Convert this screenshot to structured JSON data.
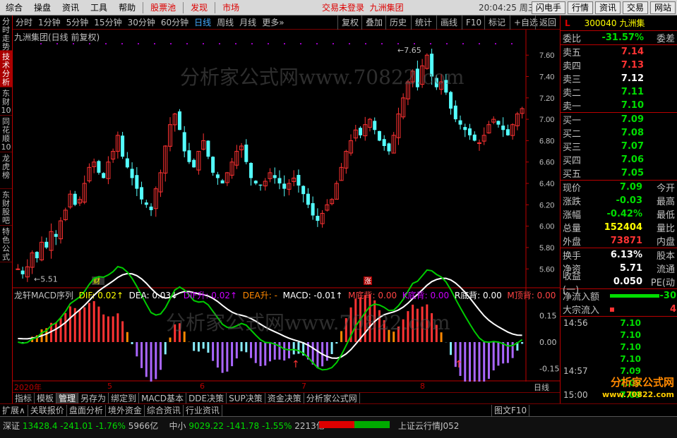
{
  "menu": {
    "items": [
      "综合",
      "操盘",
      "资讯",
      "工具",
      "帮助",
      "股票池",
      "发现",
      "市场"
    ],
    "status": "交易未登录",
    "stock_name": "九洲集团",
    "clock": "20:04:25 周三",
    "right_buttons": [
      "闪电手",
      "行情",
      "资讯",
      "交易",
      "网站"
    ]
  },
  "left_nav": [
    "分时走势",
    "技术分析",
    "东财10",
    "同花顺10",
    "龙虎榜",
    "东财股吧",
    "特色公式"
  ],
  "timeframes": [
    "分时",
    "1分钟",
    "5分钟",
    "15分钟",
    "30分钟",
    "60分钟",
    "日线",
    "周线",
    "月线",
    "更多"
  ],
  "active_timeframe": "日线",
  "toolbar": [
    "复权",
    "叠加",
    "历史",
    "统计",
    "画线",
    "F10",
    "标记",
    "+自选",
    "返回"
  ],
  "chart": {
    "title": "九洲集团(日线 前复权)",
    "high_label": "7.65",
    "low_label": "5.51",
    "y_ticks": [
      "7.60",
      "7.40",
      "7.20",
      "7.00",
      "6.80",
      "6.60",
      "6.40",
      "6.20",
      "6.00",
      "5.80",
      "5.60"
    ],
    "marker_finance": "财",
    "marker_up": "涨",
    "watermark": "分析家公式网www.70822.com",
    "date_labels": [
      "2020年",
      "5",
      "6",
      "7",
      "8"
    ],
    "period_label": "日线"
  },
  "chart_data": {
    "type": "candlestick",
    "y_range": [
      5.45,
      7.72
    ],
    "colors": {
      "up": "#ff3232",
      "down": "#54ffff"
    }
  },
  "macd": {
    "title": "龙轩MACD序列",
    "dif": "DIF: 0.02↑",
    "dea": "DEA: 0.03↓",
    "dif_up": "DIF升: 0.02↑",
    "dea_up": "DEA升: -",
    "macd": "MACD: -0.01↑",
    "m_bottom": "M底背: 0.00",
    "k_bottom": "K底背: 0.00",
    "r_bottom": "R底背: 0.00",
    "m_top": "M顶背: 0.00",
    "y_ticks": [
      "0.15",
      "0.00",
      "-0.15"
    ]
  },
  "bottom_tabs": [
    "指标",
    "模板",
    "管理",
    "另存为",
    "绑定到",
    "MACD基本",
    "DDE决策",
    "SUP决策",
    "资金决策",
    "分析家公式网"
  ],
  "active_bottom_tab": "管理",
  "ext_bar": [
    "扩展∧",
    "关联报价",
    "盘面分析",
    "境外资金",
    "综合资讯",
    "行业资讯"
  ],
  "ext_right": "图文F10",
  "footer": {
    "sz_label": "深证",
    "sz_value": "13428.4",
    "sz_change": "-241.01",
    "sz_pct": "-1.76%",
    "sz_amount": "5966亿",
    "zx_label": "中小",
    "zx_value": "9029.22",
    "zx_change": "-141.78",
    "zx_pct": "-1.55%",
    "zx_amount": "2213亿",
    "ticker": "上证云行情J052"
  },
  "quote": {
    "L": "L",
    "code": "300040",
    "name": "九洲集",
    "weibi_label": "委比",
    "weibi": "-31.57%",
    "weicha_label": "委差",
    "sells": [
      {
        "label": "卖五",
        "price": "7.14",
        "vol": ""
      },
      {
        "label": "卖四",
        "price": "7.13",
        "vol": ""
      },
      {
        "label": "卖三",
        "price": "7.12",
        "vol": ""
      },
      {
        "label": "卖二",
        "price": "7.11",
        "vol": ""
      },
      {
        "label": "卖一",
        "price": "7.10",
        "vol": ""
      }
    ],
    "buys": [
      {
        "label": "买一",
        "price": "7.09",
        "vol": ""
      },
      {
        "label": "买二",
        "price": "7.08",
        "vol": ""
      },
      {
        "label": "买三",
        "price": "7.07",
        "vol": ""
      },
      {
        "label": "买四",
        "price": "7.06",
        "vol": ""
      },
      {
        "label": "买五",
        "price": "7.05",
        "vol": ""
      }
    ],
    "info": [
      {
        "label": "现价",
        "value": "7.09",
        "label2": "今开",
        "color": "#0d0"
      },
      {
        "label": "涨跌",
        "value": "-0.03",
        "label2": "最高",
        "color": "#0d0"
      },
      {
        "label": "涨幅",
        "value": "-0.42%",
        "label2": "最低",
        "color": "#0d0"
      },
      {
        "label": "总量",
        "value": "152404",
        "label2": "量比",
        "color": "#ff0"
      },
      {
        "label": "外盘",
        "value": "73871",
        "label2": "内盘",
        "color": "#f33"
      }
    ],
    "info2": [
      {
        "label": "换手",
        "value": "6.13%",
        "label2": "股本",
        "color": "#fff"
      },
      {
        "label": "净资",
        "value": "5.71",
        "label2": "流通",
        "color": "#fff"
      },
      {
        "label": "收益(一)",
        "value": "0.050",
        "label2": "PE(动",
        "color": "#fff"
      }
    ],
    "flow": [
      {
        "label": "净流入额",
        "value": "-30"
      },
      {
        "label": "大宗流入",
        "value": "4"
      }
    ],
    "ticks": [
      {
        "time": "14:56",
        "price": "7.10"
      },
      {
        "time": "",
        "price": "7.10"
      },
      {
        "time": "",
        "price": "7.10"
      },
      {
        "time": "",
        "price": "7.10"
      },
      {
        "time": "14:57",
        "price": "7.09"
      },
      {
        "time": "",
        "price": "7.09"
      },
      {
        "time": "15:00",
        "price": "7.09"
      }
    ],
    "logo": "分析家公式网",
    "logo_url": "www.70822.com"
  }
}
